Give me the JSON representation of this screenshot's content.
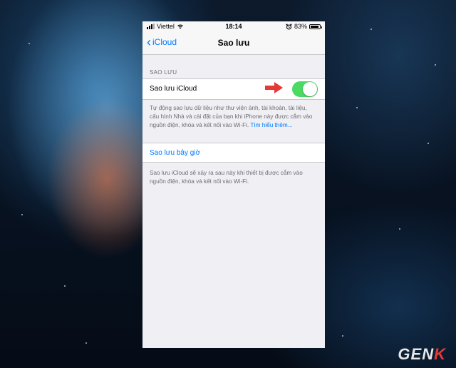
{
  "status_bar": {
    "carrier": "Viettel",
    "time": "18:14",
    "battery": "83%",
    "battery_level": 0.83
  },
  "nav": {
    "back_label": "iCloud",
    "title": "Sao lưu"
  },
  "backup_section": {
    "header": "SAO LƯU",
    "toggle_label": "Sao lưu iCloud",
    "toggle_on": true,
    "description": "Tự động sao lưu dữ liệu như thư viện ảnh, tài khoản, tài liệu, cấu hình Nhà và cài đặt của bạn khi iPhone này được cắm vào nguồn điện, khóa và kết nối vào Wi-Fi.",
    "learn_more": "Tìm hiểu thêm..."
  },
  "backup_now": {
    "label": "Sao lưu bây giờ",
    "description": "Sao lưu iCloud sẽ xảy ra sau này khi thiết bị được cắm vào nguồn điện, khóa và kết nối vào Wi-Fi."
  },
  "watermark": {
    "text_main": "GEN",
    "text_accent": "K"
  },
  "colors": {
    "ios_blue": "#007aff",
    "toggle_green": "#4cd964",
    "arrow_red": "#e53935"
  },
  "icons": [
    "signal-icon",
    "wifi-icon",
    "alarm-icon",
    "battery-icon",
    "chevron-left-icon",
    "red-arrow-icon"
  ]
}
